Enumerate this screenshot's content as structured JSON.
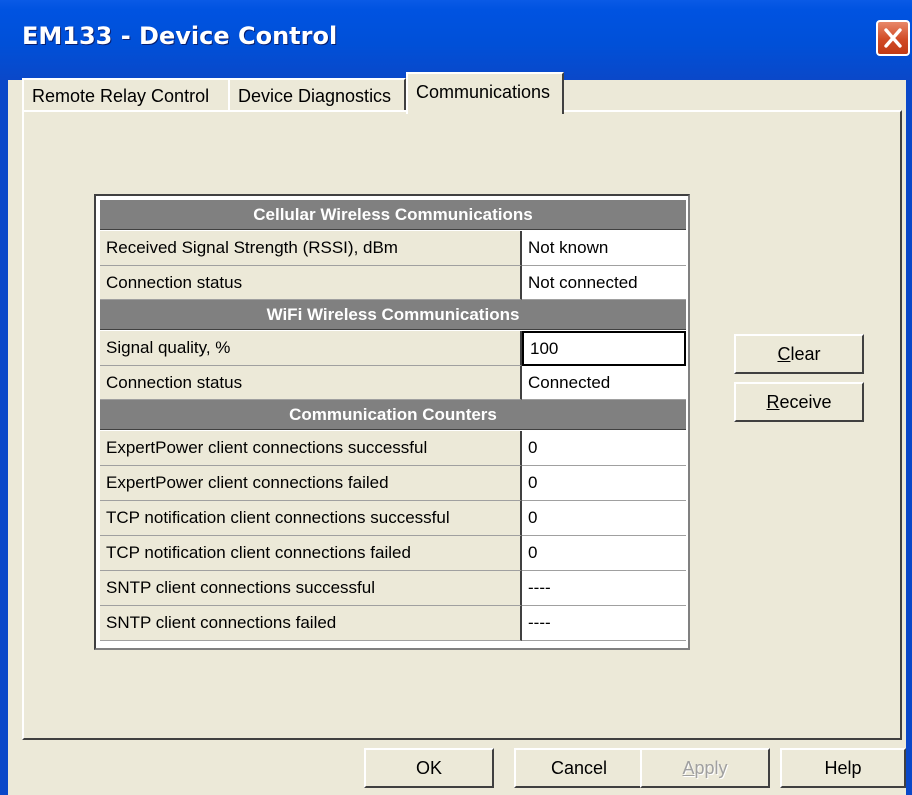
{
  "window": {
    "title": "EM133 - Device Control"
  },
  "tabs": [
    {
      "label": "Remote Relay Control",
      "active": false
    },
    {
      "label": "Device Diagnostics",
      "active": false
    },
    {
      "label": "Communications",
      "active": true
    }
  ],
  "table": {
    "sections": [
      {
        "header": "Cellular Wireless Communications",
        "rows": [
          {
            "label": "Received Signal Strength (RSSI), dBm",
            "value": "Not known"
          },
          {
            "label": "Connection status",
            "value": "Not connected"
          }
        ]
      },
      {
        "header": "WiFi Wireless Communications",
        "rows": [
          {
            "label": "Signal quality, %",
            "value": "100"
          },
          {
            "label": "Connection status",
            "value": "Connected"
          }
        ]
      },
      {
        "header": "Communication Counters",
        "rows": [
          {
            "label": "ExpertPower client connections successful",
            "value": "0"
          },
          {
            "label": "ExpertPower client connections failed",
            "value": "0"
          },
          {
            "label": "TCP notification client connections successful",
            "value": "0"
          },
          {
            "label": "TCP notification client connections failed",
            "value": "0"
          },
          {
            "label": "SNTP client connections successful",
            "value": "----"
          },
          {
            "label": "SNTP client connections failed",
            "value": "----"
          }
        ]
      }
    ]
  },
  "side_buttons": {
    "clear": {
      "label_u": "C",
      "label_rest": "lear"
    },
    "receive": {
      "label_u": "R",
      "label_rest": "eceive"
    }
  },
  "footer_buttons": {
    "ok": "OK",
    "cancel": "Cancel",
    "apply": {
      "label_u": "A",
      "label_rest": "pply",
      "enabled": false
    },
    "help": "Help"
  },
  "icons": {
    "close": "close-icon"
  },
  "colors": {
    "titlebar": "#0050d8",
    "close_button": "#d14a25",
    "dialog_bg": "#ece9d8",
    "section_header_bg": "#808080"
  }
}
